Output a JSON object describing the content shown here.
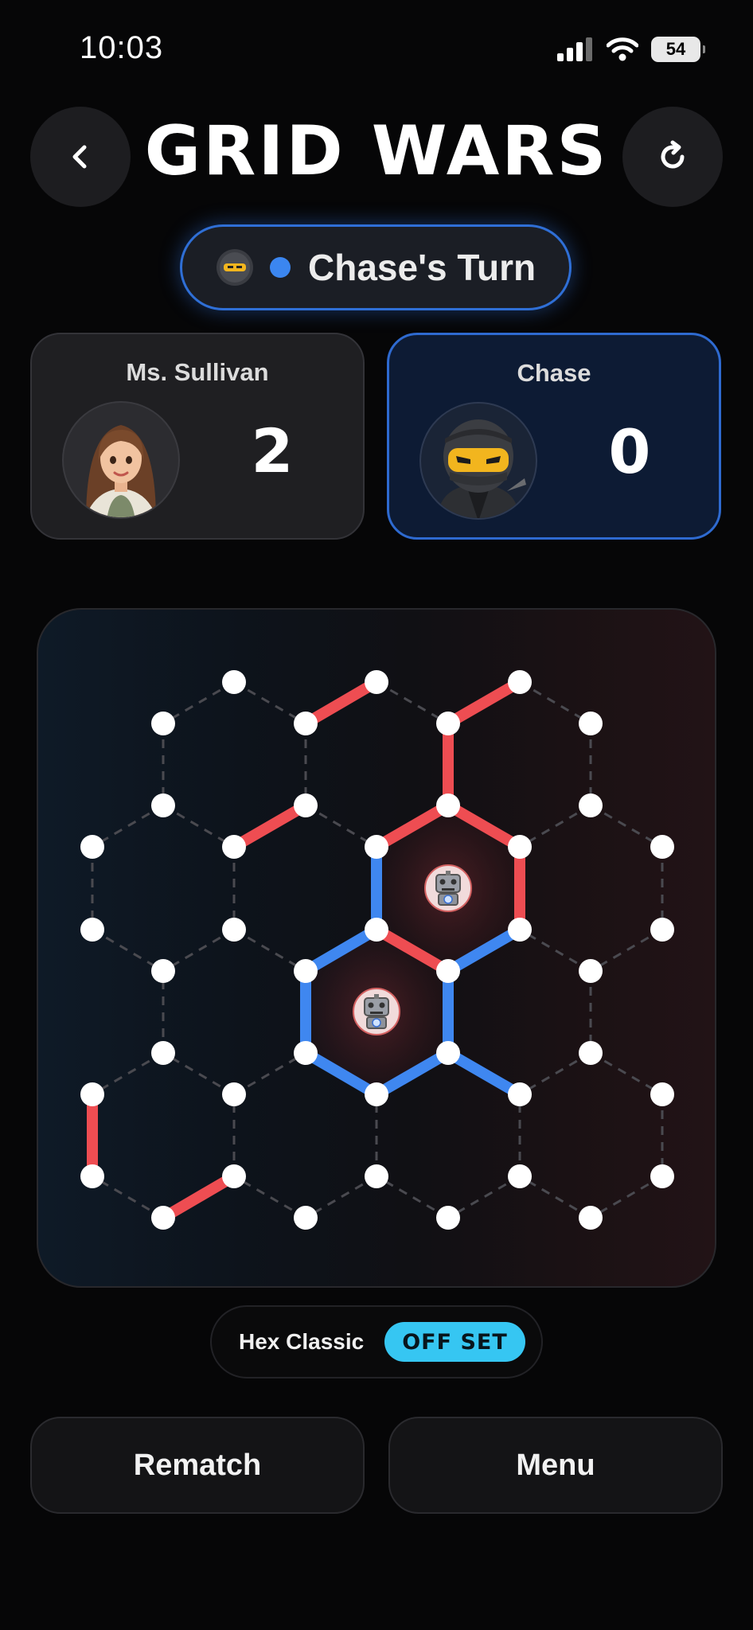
{
  "status_bar": {
    "time": "10:03",
    "battery": "54"
  },
  "header": {
    "title": "GRID WARS",
    "back_icon": "chevron-left-icon",
    "restart_icon": "refresh-icon"
  },
  "turn_indicator": {
    "text": "Chase's Turn",
    "dot_color": "#3b86f0"
  },
  "players": [
    {
      "name": "Ms. Sullivan",
      "score": "2",
      "color": "#f0474d",
      "avatar": "woman-avatar"
    },
    {
      "name": "Chase",
      "score": "0",
      "color": "#3b86f0",
      "avatar": "ninja-avatar",
      "active": true
    }
  ],
  "board": {
    "owned_cell_icon": "robot-icon",
    "colors": {
      "red": "#ee4d52",
      "blue": "#3f87f0",
      "grid": "#4a4a50",
      "dot": "#ffffff"
    }
  },
  "mode": {
    "label": "Hex Classic",
    "badge": "OFF SET"
  },
  "actions": {
    "rematch": "Rematch",
    "menu": "Menu"
  }
}
